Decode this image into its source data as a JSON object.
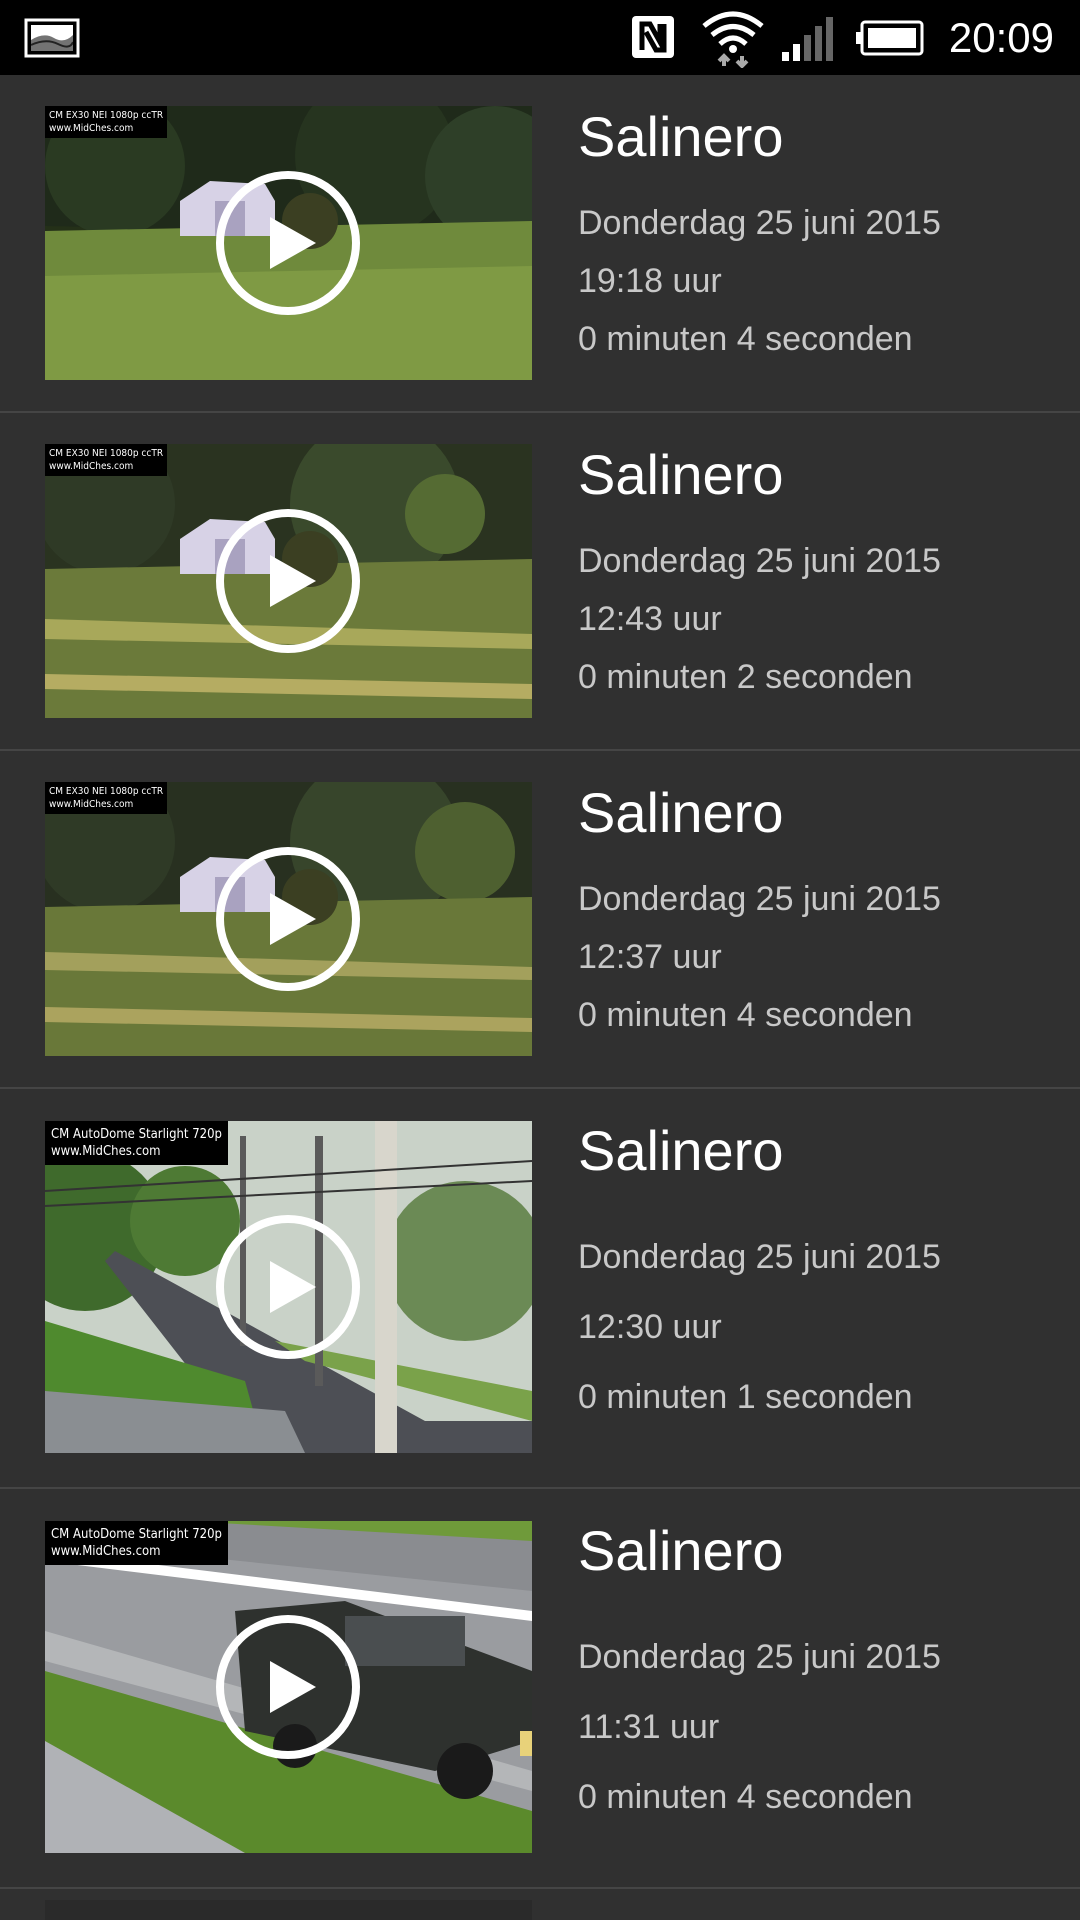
{
  "status_bar": {
    "time": "20:09",
    "icons": [
      "gallery-icon",
      "nfc-icon",
      "wifi-icon",
      "cell-signal-icon",
      "battery-icon"
    ]
  },
  "items": [
    {
      "title": "Salinero",
      "date": "Donderdag 25 juni 2015",
      "time": "19:18 uur",
      "duration": "0 minuten 4 seconden",
      "overlay": "CM EX30 NEI 1080p ccTR\nwww.MidChes.com"
    },
    {
      "title": "Salinero",
      "date": "Donderdag 25 juni 2015",
      "time": "12:43 uur",
      "duration": "0 minuten 2 seconden",
      "overlay": "CM EX30 NEI 1080p ccTR\nwww.MidChes.com"
    },
    {
      "title": "Salinero",
      "date": "Donderdag 25 juni 2015",
      "time": "12:37 uur",
      "duration": "0 minuten 4 seconden",
      "overlay": "CM EX30 NEI 1080p ccTR\nwww.MidChes.com"
    },
    {
      "title": "Salinero",
      "date": "Donderdag 25 juni 2015",
      "time": "12:30 uur",
      "duration": "0 minuten 1 seconden",
      "overlay": "CM AutoDome Starlight 720p\nwww.MidChes.com"
    },
    {
      "title": "Salinero",
      "date": "Donderdag 25 juni 2015",
      "time": "11:31 uur",
      "duration": "0 minuten 4 seconden",
      "overlay": "CM AutoDome Starlight 720p\nwww.MidChes.com"
    }
  ]
}
